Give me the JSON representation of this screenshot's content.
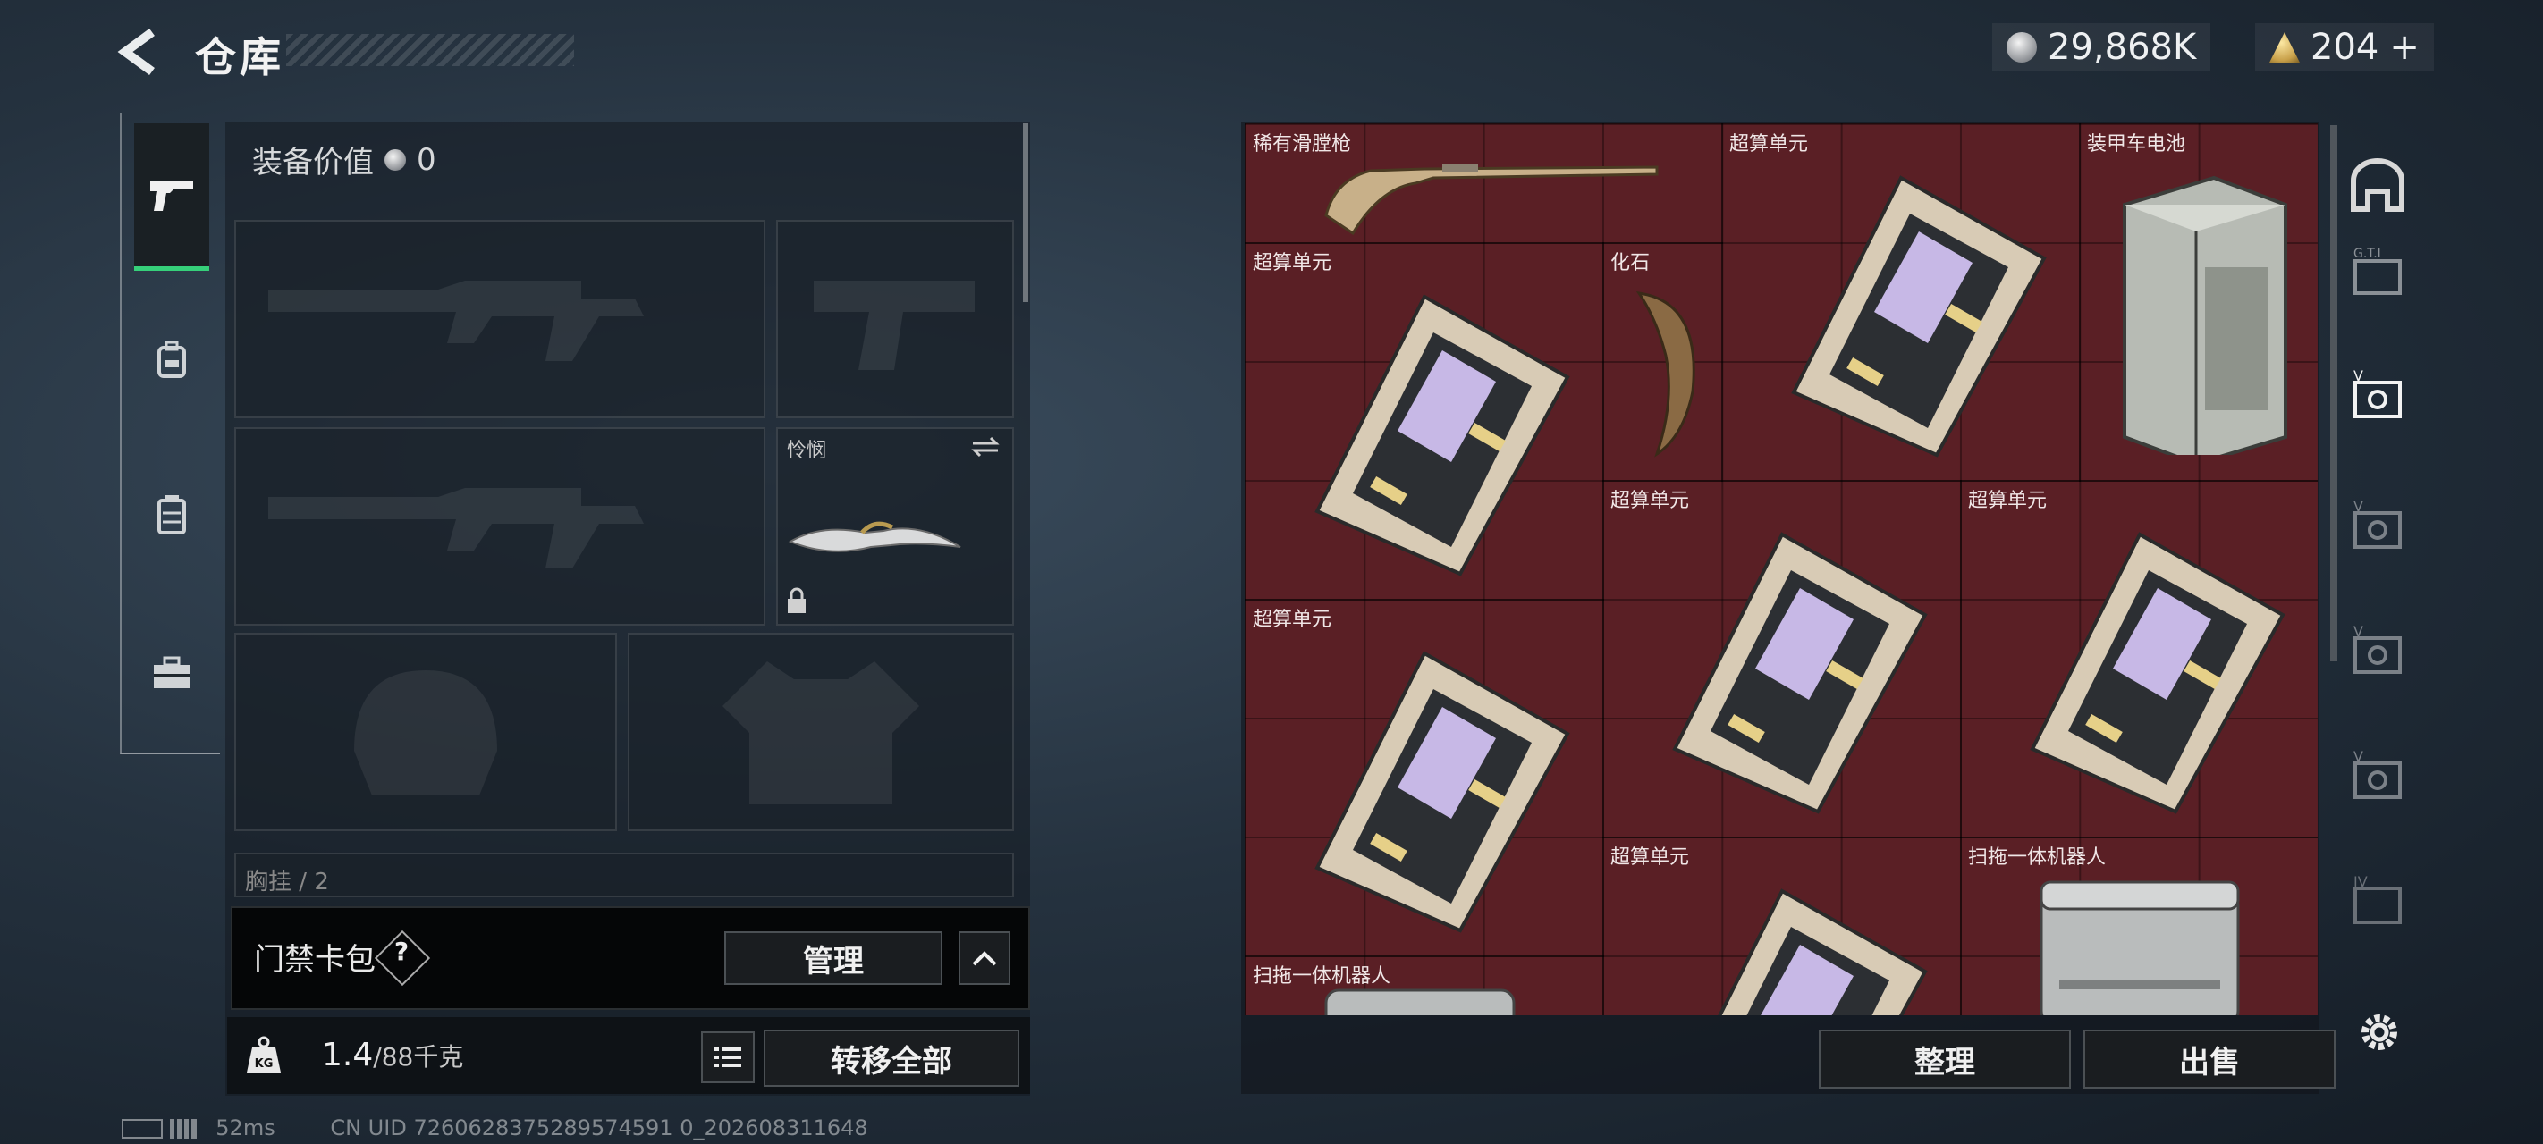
{
  "header": {
    "title": "仓库",
    "currency_primary": "29,868K",
    "currency_secondary": "204",
    "currency_secondary_add": "+"
  },
  "left_rail": {
    "items": [
      {
        "icon": "pistol-icon",
        "active": true
      },
      {
        "icon": "backpack-icon",
        "active": false
      },
      {
        "icon": "vest-icon",
        "active": false
      },
      {
        "icon": "toolbox-icon",
        "active": false
      }
    ]
  },
  "equipment": {
    "value_label": "装备价值",
    "value": "0",
    "melee_label": "怜悯",
    "chest_label": "胸挂",
    "chest_count": "2"
  },
  "access_card": {
    "label": "门禁卡包",
    "help": "?",
    "manage_label": "管理"
  },
  "weight": {
    "current": "1.4",
    "max": "/88千克",
    "transfer_all_label": "转移全部"
  },
  "status": {
    "ping": "52ms",
    "uid": "CN UID 7260628375289574591 0_202608311648"
  },
  "storage": {
    "items": [
      {
        "label": "稀有滑膛枪",
        "icon": "musket-icon"
      },
      {
        "label": "超算单元",
        "icon": "compute-unit-icon"
      },
      {
        "label": "装甲车电池",
        "icon": "battery-icon"
      },
      {
        "label": "超算单元",
        "icon": "compute-unit-icon"
      },
      {
        "label": "化石",
        "icon": "fossil-claw-icon"
      },
      {
        "label": "超算单元",
        "icon": "compute-unit-icon"
      },
      {
        "label": "超算单元",
        "icon": "compute-unit-icon"
      },
      {
        "label": "超算单元",
        "icon": "compute-unit-icon"
      },
      {
        "label": "超算单元",
        "icon": "compute-unit-icon"
      },
      {
        "label": "扫拖一体机器人",
        "icon": "robot-vacuum-icon"
      },
      {
        "label": "扫拖一体机器人",
        "icon": "robot-vacuum-icon"
      }
    ],
    "sort_label": "整理",
    "sell_label": "出售",
    "side_tabs": [
      "home-icon",
      "gti-tab-icon",
      "v-tab-icon",
      "v-tab-icon",
      "v-tab-icon",
      "v-tab-icon",
      "iv-tab-icon"
    ],
    "side_tab_labels": [
      "",
      "G.T.I",
      "V",
      "V",
      "V",
      "V",
      "IV"
    ]
  },
  "colors": {
    "grid_bg": "#5a1f25",
    "active_tab": "#36d07a",
    "panel_bg": "#141a20"
  }
}
